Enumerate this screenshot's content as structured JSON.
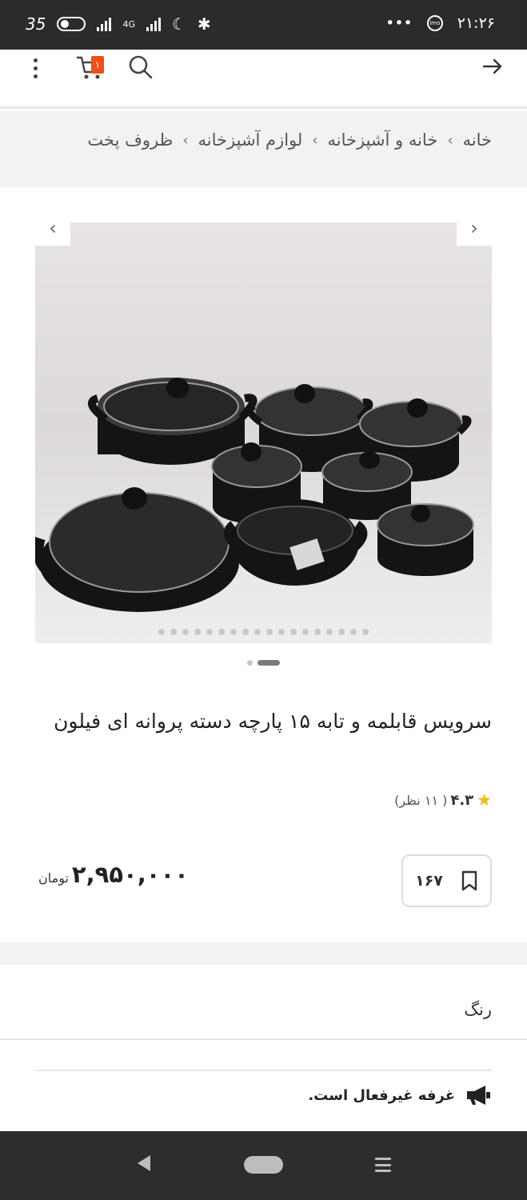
{
  "status_bar": {
    "left_text": "35",
    "network": "4G",
    "time": "۲۱:۲۶",
    "dots": "•••",
    "imo_label": "imo"
  },
  "header": {
    "back_icon": "arrow-right-icon",
    "cart_badge": "۱"
  },
  "breadcrumb": {
    "items": [
      "خانه",
      "خانه و آشپزخانه",
      "لوازم آشپزخانه",
      "ظروف پخت"
    ],
    "separator": "‹"
  },
  "gallery": {
    "prev_icon": "‹",
    "next_icon": "›",
    "thumb_count": 18
  },
  "product": {
    "title": "سرویس قابلمه و تابه ۱۵ پارچه دسته پروانه ای فیلون",
    "rating": "۴.۳",
    "reviews": "( ۱۱ نظر)",
    "star": "★",
    "like_count": "۱۶۷",
    "price": "۲,۹۵۰,۰۰۰",
    "currency": "تومان"
  },
  "color_section": {
    "label": "رنگ"
  },
  "notice": {
    "text": "غرفه غیرفعال است."
  },
  "colors": {
    "status_bg": "#2b2b2b",
    "accent_orange": "#ef4f1b",
    "star": "#f9b816"
  }
}
